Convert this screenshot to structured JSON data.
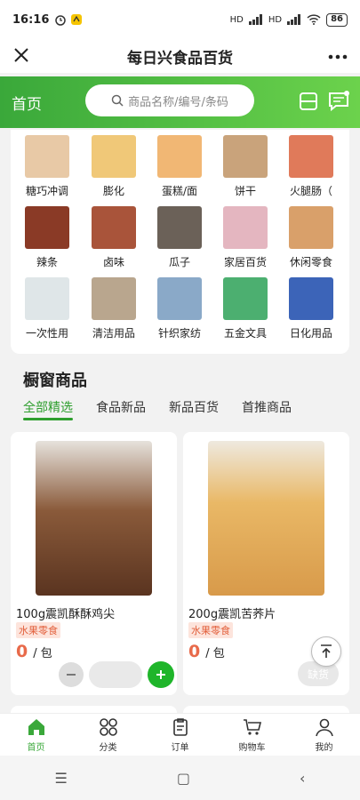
{
  "status": {
    "time": "16:16",
    "net1": "HD",
    "net2": "HD",
    "battery": "86"
  },
  "titlebar": {
    "title": "每日兴食品百货"
  },
  "header": {
    "home_label": "首页",
    "search_placeholder": "商品名称/编号/条码"
  },
  "categories": [
    {
      "label": "糖巧冲调",
      "color": "#e8c9a6"
    },
    {
      "label": "膨化",
      "color": "#f0c878"
    },
    {
      "label": "蛋糕/面",
      "color": "#f1b774"
    },
    {
      "label": "饼干",
      "color": "#c9a37b"
    },
    {
      "label": "火腿肠（",
      "color": "#e07a5a"
    },
    {
      "label": "辣条",
      "color": "#8a3a26"
    },
    {
      "label": "卤味",
      "color": "#a9543a"
    },
    {
      "label": "瓜子",
      "color": "#6b6158"
    },
    {
      "label": "家居百货",
      "color": "#e4b6c0"
    },
    {
      "label": "休闲零食",
      "color": "#d9a06a"
    },
    {
      "label": "一次性用",
      "color": "#dfe6e8"
    },
    {
      "label": "清洁用品",
      "color": "#b9a68e"
    },
    {
      "label": "针织家纺",
      "color": "#8aa9c8"
    },
    {
      "label": "五金文具",
      "color": "#4caf70"
    },
    {
      "label": "日化用品",
      "color": "#3c64b8"
    }
  ],
  "section": {
    "title": "橱窗商品"
  },
  "tabs": [
    "全部精选",
    "食品新品",
    "新品百货",
    "首推商品"
  ],
  "products": [
    {
      "name": "100g震凯酥酥鸡尖",
      "tag": "水果零食",
      "price": "0",
      "unit": "/ 包",
      "color": "#7a4a2a"
    },
    {
      "name": "200g震凯苦荞片",
      "tag": "水果零食",
      "price": "0",
      "unit": "/ 包",
      "color": "#d9a55a",
      "soldout": "缺货"
    }
  ],
  "nav": [
    {
      "label": "首页"
    },
    {
      "label": "分类"
    },
    {
      "label": "订单"
    },
    {
      "label": "购物车"
    },
    {
      "label": "我的"
    }
  ],
  "sysnav": {
    "menu": "☰",
    "home": "▢",
    "back": "‹"
  }
}
